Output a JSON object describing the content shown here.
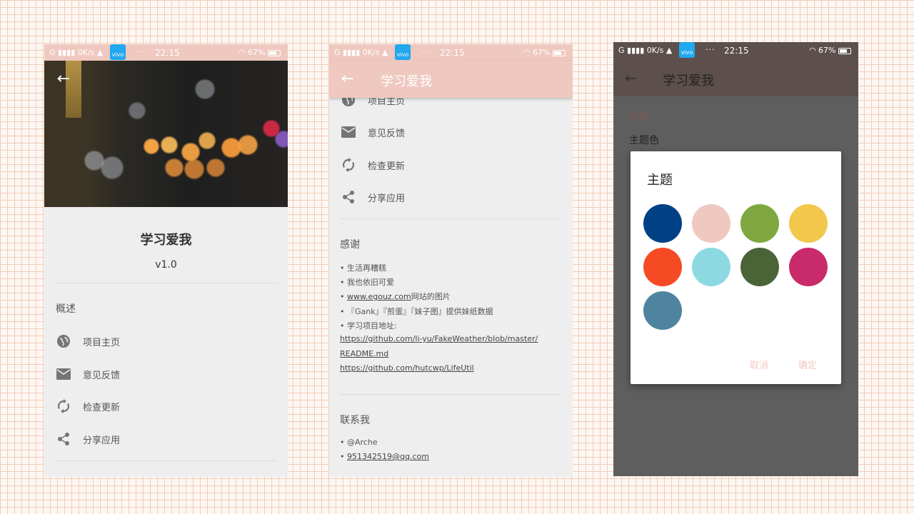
{
  "status": {
    "network": "G",
    "speed": "0K/s",
    "app_badge": "vivo",
    "dots": "···",
    "time": "22:15",
    "battery": "67%"
  },
  "about": {
    "app_name": "学习爱我",
    "version": "v1.0",
    "overview_title": "概述",
    "items": [
      {
        "label": "项目主页",
        "icon": "globe-icon"
      },
      {
        "label": "意见反馈",
        "icon": "mail-icon"
      },
      {
        "label": "检查更新",
        "icon": "sync-icon"
      },
      {
        "label": "分享应用",
        "icon": "share-icon"
      }
    ]
  },
  "scrolled": {
    "toolbar_title": "学习爱我",
    "items": [
      {
        "label": "项目主页",
        "icon": "globe-icon"
      },
      {
        "label": "意见反馈",
        "icon": "mail-icon"
      },
      {
        "label": "检查更新",
        "icon": "sync-icon"
      },
      {
        "label": "分享应用",
        "icon": "share-icon"
      }
    ],
    "thanks_title": "感谢",
    "thanks": [
      {
        "bullet": "•",
        "text": "生活再糟糕"
      },
      {
        "bullet": "•",
        "text": "我也依旧可爱"
      },
      {
        "bullet": "•",
        "link": "www.egouz.com",
        "text": "网站的图片"
      },
      {
        "bullet": "•",
        "text": "『Gank』『煎蛋』『妹子图』提供妹纸数据"
      },
      {
        "bullet": "•",
        "text": "学习项目地址:"
      }
    ],
    "links": [
      "https://github.com/li-yu/FakeWeather/blob/master/",
      "README.md",
      "https://github.com/hutcwp/LifeUtil"
    ],
    "contact_title": "联系我",
    "contacts": [
      {
        "bullet": "•",
        "text": "@Arche"
      },
      {
        "bullet": "•",
        "link": "951342519@qq.com"
      }
    ]
  },
  "theme": {
    "toolbar_title": "学习爱我",
    "settings_label": "设置",
    "theme_color_label": "主题色",
    "dialog_title": "主题",
    "swatches": [
      "#004185",
      "#efc8bf",
      "#7ea83f",
      "#f2c84c",
      "#f64a25",
      "#8dd9e2",
      "#4b6437",
      "#c82a6a",
      "#4f84a0"
    ],
    "cancel": "取消",
    "confirm": "确定"
  }
}
